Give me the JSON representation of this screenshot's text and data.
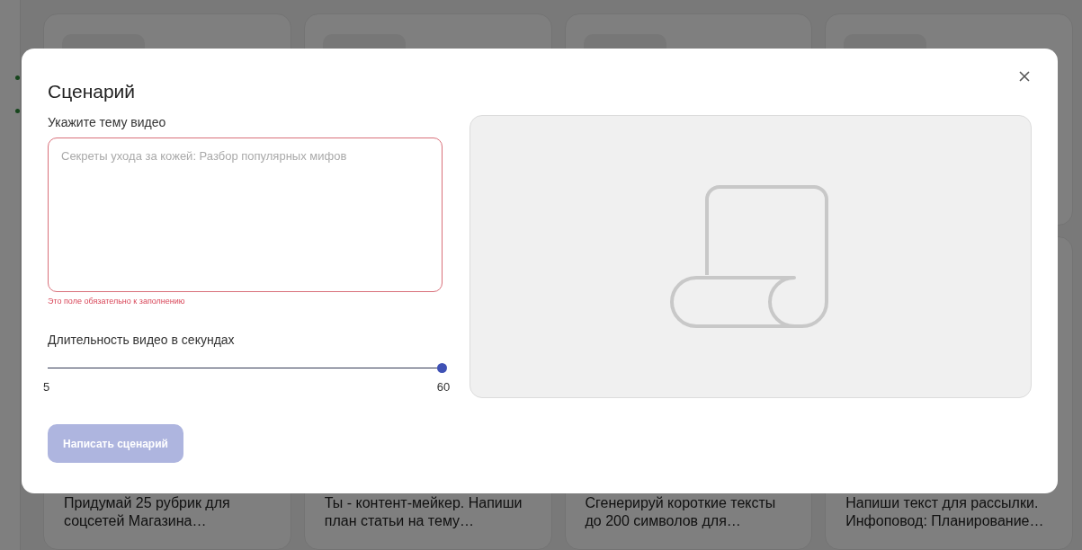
{
  "background_cards": [
    {
      "description": "Придумай 25 рубрик для соцсетей Магазина…"
    },
    {
      "description": "Ты - контент-мейкер. Напиши план статьи на тему…"
    },
    {
      "description": "Сгенерируй короткие тексты до 200 символов для…"
    },
    {
      "description": "Напиши текст для рассылки. Инфоповод: Планирование…"
    }
  ],
  "dialog": {
    "title": "Сценарий",
    "topic": {
      "label": "Укажите тему видео",
      "placeholder": "Секреты ухода за кожей: Разбор популярных мифов",
      "error": "Это поле обязательно к заполнению"
    },
    "duration": {
      "label": "Длительность видео в секундах",
      "level": 1,
      "min": "5",
      "max": "60"
    },
    "submit": {
      "label": "Написать сценарий",
      "disabled": true
    }
  }
}
